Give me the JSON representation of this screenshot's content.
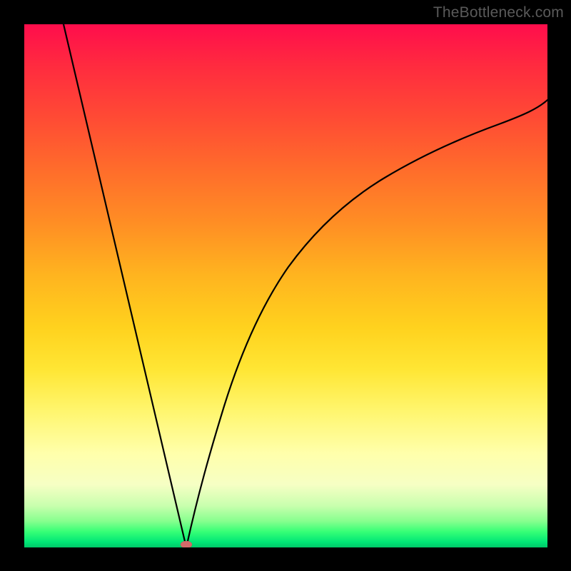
{
  "watermark": {
    "text": "TheBottleneck.com"
  },
  "colors": {
    "frame_bg": "#000000",
    "curve_stroke": "#000000",
    "cusp_fill": "#d46a6a",
    "gradient_stops": [
      "#ff0d4c",
      "#ff4b34",
      "#ff8e24",
      "#ffd21e",
      "#ffffab",
      "#00e676"
    ]
  },
  "chart_data": {
    "type": "line",
    "title": "",
    "xlabel": "",
    "ylabel": "",
    "xlim": [
      0,
      100
    ],
    "ylim": [
      0,
      100
    ],
    "grid": false,
    "legend": false,
    "annotations": [
      {
        "kind": "cusp_marker",
        "x": 31,
        "y": 0
      }
    ],
    "series": [
      {
        "name": "left-branch",
        "x": [
          7.5,
          10,
          12.5,
          15,
          17.5,
          20,
          22.5,
          25,
          27.5,
          30,
          31
        ],
        "values": [
          100,
          89.4,
          78.7,
          68.1,
          57.4,
          46.8,
          36.2,
          25.5,
          14.9,
          4.3,
          0
        ]
      },
      {
        "name": "right-branch",
        "x": [
          31,
          33,
          35,
          38,
          41,
          45,
          50,
          55,
          60,
          65,
          70,
          75,
          80,
          85,
          90,
          95,
          100
        ],
        "values": [
          0,
          9,
          17,
          27,
          35,
          44,
          53,
          60,
          65.5,
          70,
          73.5,
          76.5,
          79,
          81,
          82.8,
          84.3,
          85.5
        ]
      }
    ]
  }
}
